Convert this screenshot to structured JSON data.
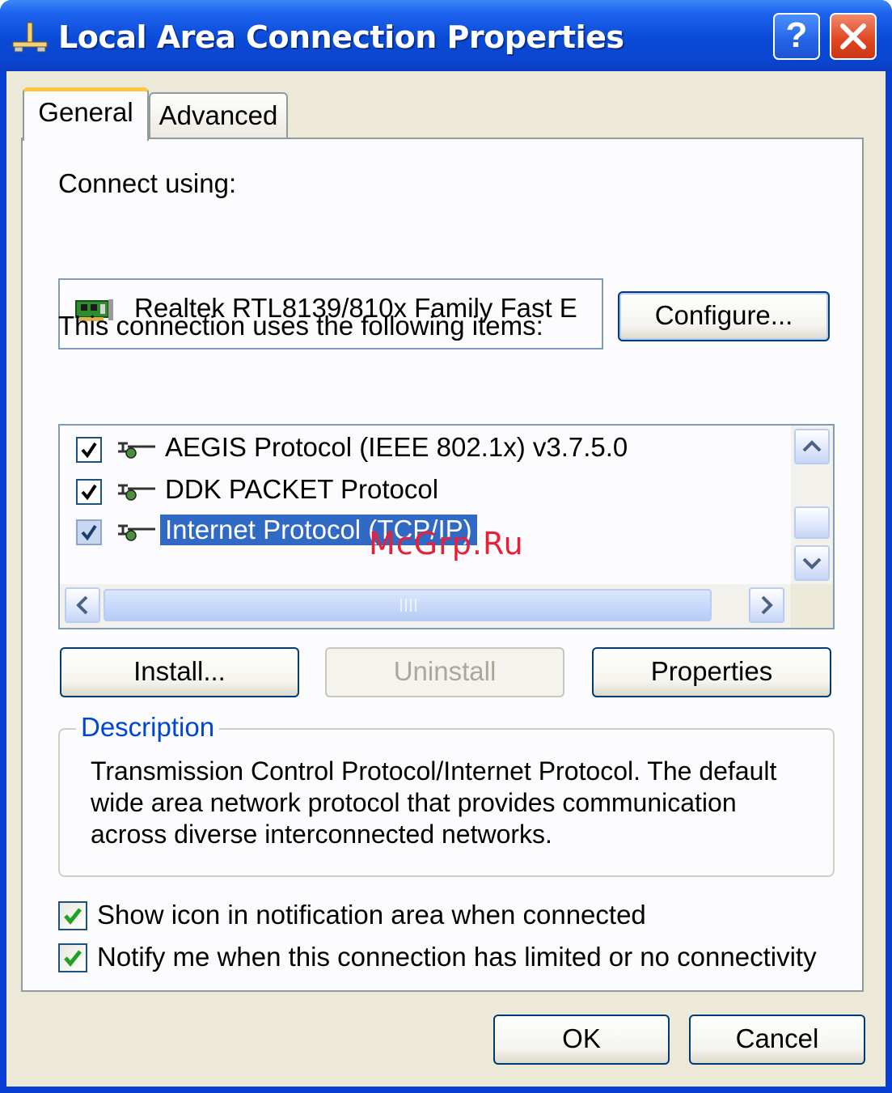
{
  "window": {
    "title": "Local Area Connection Properties",
    "help_label": "?",
    "close_label": "✕"
  },
  "tabs": [
    {
      "label": "General"
    },
    {
      "label": "Advanced"
    }
  ],
  "connect_using": {
    "label": "Connect using:",
    "adapter": "Realtek RTL8139/810x Family Fast E",
    "configure_label": "Configure..."
  },
  "items": {
    "label": "This connection uses the following items:",
    "rows": [
      {
        "label": "AEGIS Protocol (IEEE 802.1x) v3.7.5.0",
        "checked": true,
        "selected": false
      },
      {
        "label": "DDK PACKET Protocol",
        "checked": true,
        "selected": false
      },
      {
        "label": "Internet Protocol (TCP/IP)",
        "checked": true,
        "selected": true
      }
    ]
  },
  "buttons": {
    "install": "Install...",
    "uninstall": "Uninstall",
    "properties": "Properties",
    "ok": "OK",
    "cancel": "Cancel"
  },
  "description": {
    "title": "Description",
    "lines": [
      "Transmission Control Protocol/Internet Protocol. The default",
      "wide area network protocol that provides communication",
      "across diverse interconnected networks."
    ]
  },
  "options": [
    {
      "label": "Show icon in notification area when connected",
      "checked": true
    },
    {
      "label": "Notify me when this connection has limited or no connectivity",
      "checked": true
    }
  ],
  "watermark": "McGrp.Ru",
  "colors": {
    "title_blue": "#0a4ad8",
    "selection": "#316ac5",
    "group_title": "#0046d5",
    "check_green": "#21a121",
    "close_red": "#e0441f"
  }
}
